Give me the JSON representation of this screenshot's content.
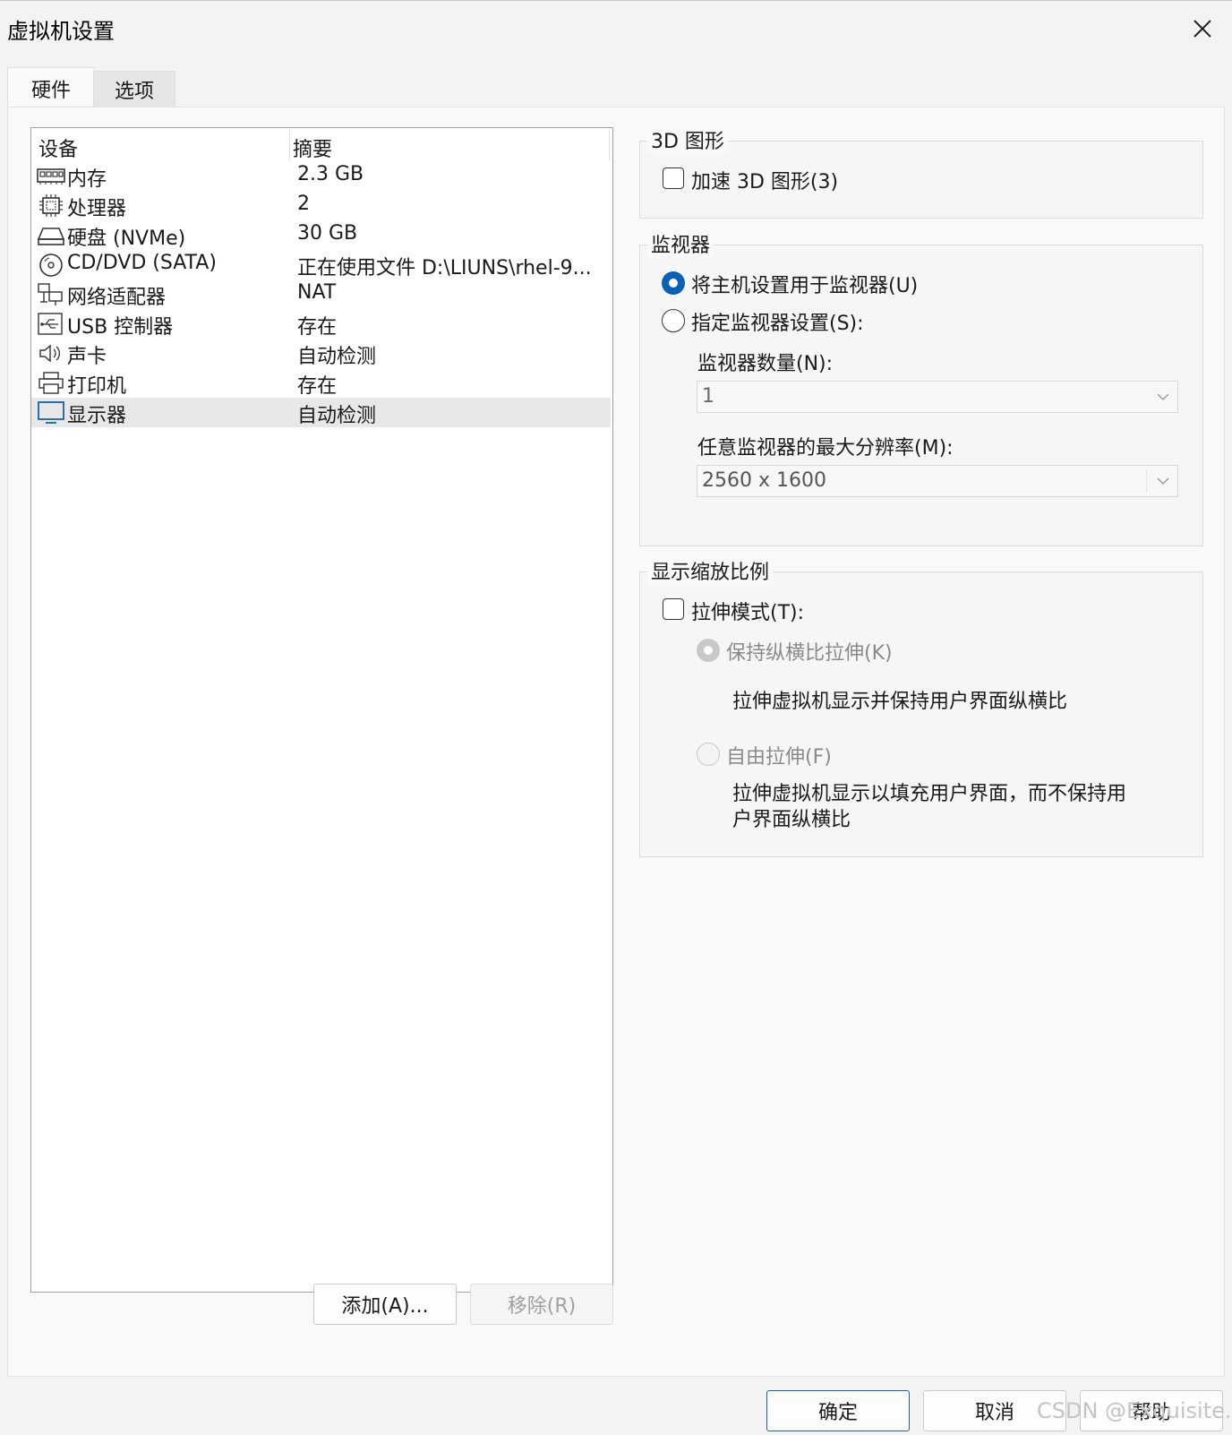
{
  "window": {
    "title": "虚拟机设置"
  },
  "tabs": [
    {
      "label": "硬件",
      "active": true
    },
    {
      "label": "选项",
      "active": false
    }
  ],
  "device_table": {
    "columns": [
      "设备",
      "摘要"
    ],
    "rows": [
      {
        "icon": "memory-icon",
        "device": "内存",
        "summary": "2.3 GB"
      },
      {
        "icon": "processor-icon",
        "device": "处理器",
        "summary": "2"
      },
      {
        "icon": "hard-disk-icon",
        "device": "硬盘 (NVMe)",
        "summary": "30 GB"
      },
      {
        "icon": "cd-dvd-icon",
        "device": "CD/DVD (SATA)",
        "summary": "正在使用文件 D:\\LIUNS\\rhel-9..."
      },
      {
        "icon": "network-adapter-icon",
        "device": "网络适配器",
        "summary": "NAT"
      },
      {
        "icon": "usb-icon",
        "device": "USB 控制器",
        "summary": "存在"
      },
      {
        "icon": "sound-card-icon",
        "device": "声卡",
        "summary": "自动检测"
      },
      {
        "icon": "printer-icon",
        "device": "打印机",
        "summary": "存在"
      },
      {
        "icon": "display-icon",
        "device": "显示器",
        "summary": "自动检测",
        "selected": true
      }
    ]
  },
  "list_buttons": {
    "add": "添加(A)...",
    "remove": "移除(R)"
  },
  "graphics3d": {
    "title": "3D 图形",
    "accelerate_label": "加速 3D 图形(3)",
    "accelerate_checked": false
  },
  "monitors": {
    "title": "监视器",
    "use_host_label": "将主机设置用于监视器(U)",
    "use_host_selected": true,
    "specify_label": "指定监视器设置(S):",
    "count_label": "监视器数量(N):",
    "count_value": "1",
    "max_res_label": "任意监视器的最大分辨率(M):",
    "max_res_value": "2560 x 1600"
  },
  "scaling": {
    "title": "显示缩放比例",
    "stretch_label": "拉伸模式(T):",
    "stretch_checked": false,
    "keep_aspect_label": "保持纵横比拉伸(K)",
    "keep_aspect_desc": "拉伸虚拟机显示并保持用户界面纵横比",
    "free_label": "自由拉伸(F)",
    "free_desc_line1": "拉伸虚拟机显示以填充用户界面，而不保持用",
    "free_desc_line2": "户界面纵横比"
  },
  "footer": {
    "ok": "确定",
    "cancel": "取消",
    "help": "帮助"
  },
  "watermark": "CSDN @Exquisite."
}
